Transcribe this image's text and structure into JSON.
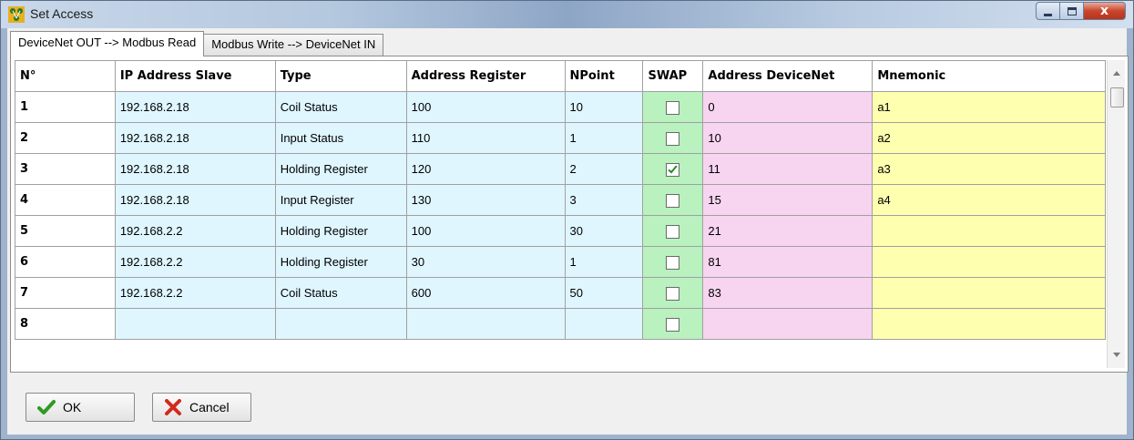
{
  "window": {
    "title": "Set Access",
    "close_glyph": "x"
  },
  "tabs": [
    {
      "label": "DeviceNet OUT --> Modbus Read",
      "active": true
    },
    {
      "label": "Modbus Write --> DeviceNet IN",
      "active": false
    }
  ],
  "table": {
    "headers": [
      "N°",
      "IP Address Slave",
      "Type",
      "Address Register",
      "NPoint",
      "SWAP",
      "Address DeviceNet",
      "Mnemonic"
    ],
    "rows": [
      {
        "n": "1",
        "ip": "192.168.2.18",
        "type": "Coil Status",
        "addr": "100",
        "npoint": "10",
        "swap": false,
        "devnet": "0",
        "mnemonic": "a1"
      },
      {
        "n": "2",
        "ip": "192.168.2.18",
        "type": "Input Status",
        "addr": "110",
        "npoint": "1",
        "swap": false,
        "devnet": "10",
        "mnemonic": "a2"
      },
      {
        "n": "3",
        "ip": "192.168.2.18",
        "type": "Holding Register",
        "addr": "120",
        "npoint": "2",
        "swap": true,
        "devnet": "11",
        "mnemonic": "a3"
      },
      {
        "n": "4",
        "ip": "192.168.2.18",
        "type": "Input Register",
        "addr": "130",
        "npoint": "3",
        "swap": false,
        "devnet": "15",
        "mnemonic": "a4"
      },
      {
        "n": "5",
        "ip": "192.168.2.2",
        "type": "Holding Register",
        "addr": "100",
        "npoint": "30",
        "swap": false,
        "devnet": "21",
        "mnemonic": ""
      },
      {
        "n": "6",
        "ip": "192.168.2.2",
        "type": "Holding Register",
        "addr": "30",
        "npoint": "1",
        "swap": false,
        "devnet": "81",
        "mnemonic": ""
      },
      {
        "n": "7",
        "ip": "192.168.2.2",
        "type": "Coil Status",
        "addr": "600",
        "npoint": "50",
        "swap": false,
        "devnet": "83",
        "mnemonic": ""
      },
      {
        "n": "8",
        "ip": "",
        "type": "",
        "addr": "",
        "npoint": "",
        "swap": false,
        "devnet": "",
        "mnemonic": ""
      }
    ]
  },
  "buttons": {
    "ok_label": "OK",
    "cancel_label": "Cancel"
  },
  "icons": {
    "app": "network-nodes-icon",
    "ok": "checkmark-icon",
    "cancel": "red-x-icon"
  },
  "colors": {
    "ip_column": "#dff6ff",
    "swap_column": "#b9f1bf",
    "devicenet_column": "#f7d5f1",
    "mnemonic_column": "#ffffb0"
  }
}
